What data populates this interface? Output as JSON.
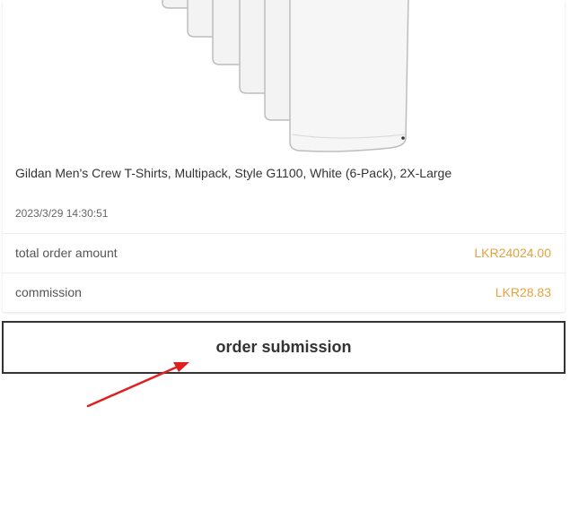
{
  "product": {
    "image_icon": "white-tshirt-multipack-image",
    "title": "Gildan Men's Crew T-Shirts, Multipack, Style G1100, White (6-Pack), 2X-Large",
    "order_time": "2023/3/29 14:30:51"
  },
  "summary": {
    "total_label": "total order amount",
    "total_value": "LKR24024.00",
    "commission_label": "commission",
    "commission_value": "LKR28.83",
    "value_color": "#e6a23c"
  },
  "actions": {
    "submit_label": "order submission"
  },
  "annotation": {
    "arrow_icon": "red-arrow-icon",
    "arrow_color": "#e02020"
  }
}
